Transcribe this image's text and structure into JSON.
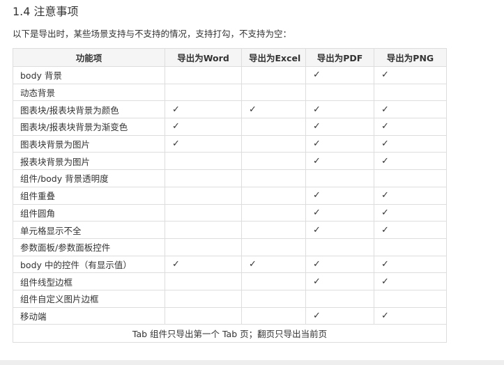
{
  "section_title": "1.4 注意事项",
  "intro": "以下是导出时，某些场景支持与不支持的情况，支持打勾，不支持为空：",
  "check_glyph": "✓",
  "table": {
    "headers": [
      "功能项",
      "导出为Word",
      "导出为Excel",
      "导出为PDF",
      "导出为PNG"
    ],
    "rows": [
      {
        "name": "body 背景",
        "cells": [
          "",
          "",
          "✓",
          "✓"
        ]
      },
      {
        "name": "动态背景",
        "cells": [
          "",
          "",
          "",
          ""
        ]
      },
      {
        "name": "图表块/报表块背景为颜色",
        "cells": [
          "✓",
          "✓",
          "✓",
          "✓"
        ]
      },
      {
        "name": "图表块/报表块背景为渐变色",
        "cells": [
          "✓",
          "",
          "✓",
          "✓"
        ]
      },
      {
        "name": "图表块背景为图片",
        "cells": [
          "✓",
          "",
          "✓",
          "✓"
        ]
      },
      {
        "name": "报表块背景为图片",
        "cells": [
          "",
          "",
          "✓",
          "✓"
        ]
      },
      {
        "name": "组件/body 背景透明度",
        "cells": [
          "",
          "",
          "",
          ""
        ]
      },
      {
        "name": "组件重叠",
        "cells": [
          "",
          "",
          "✓",
          "✓"
        ]
      },
      {
        "name": "组件圆角",
        "cells": [
          "",
          "",
          "✓",
          "✓"
        ]
      },
      {
        "name": "单元格显示不全",
        "cells": [
          "",
          "",
          "✓",
          "✓"
        ]
      },
      {
        "name": "参数面板/参数面板控件",
        "cells": [
          "",
          "",
          "",
          ""
        ]
      },
      {
        "name": "body 中的控件（有显示值）",
        "cells": [
          "✓",
          "✓",
          "✓",
          "✓"
        ]
      },
      {
        "name": "组件线型边框",
        "cells": [
          "",
          "",
          "✓",
          "✓"
        ]
      },
      {
        "name": "组件自定义图片边框",
        "cells": [
          "",
          "",
          "",
          ""
        ]
      },
      {
        "name": "移动端",
        "cells": [
          "",
          "",
          "✓",
          "✓"
        ]
      }
    ],
    "footer": "Tab 组件只导出第一个 Tab 页；翻页只导出当前页"
  }
}
